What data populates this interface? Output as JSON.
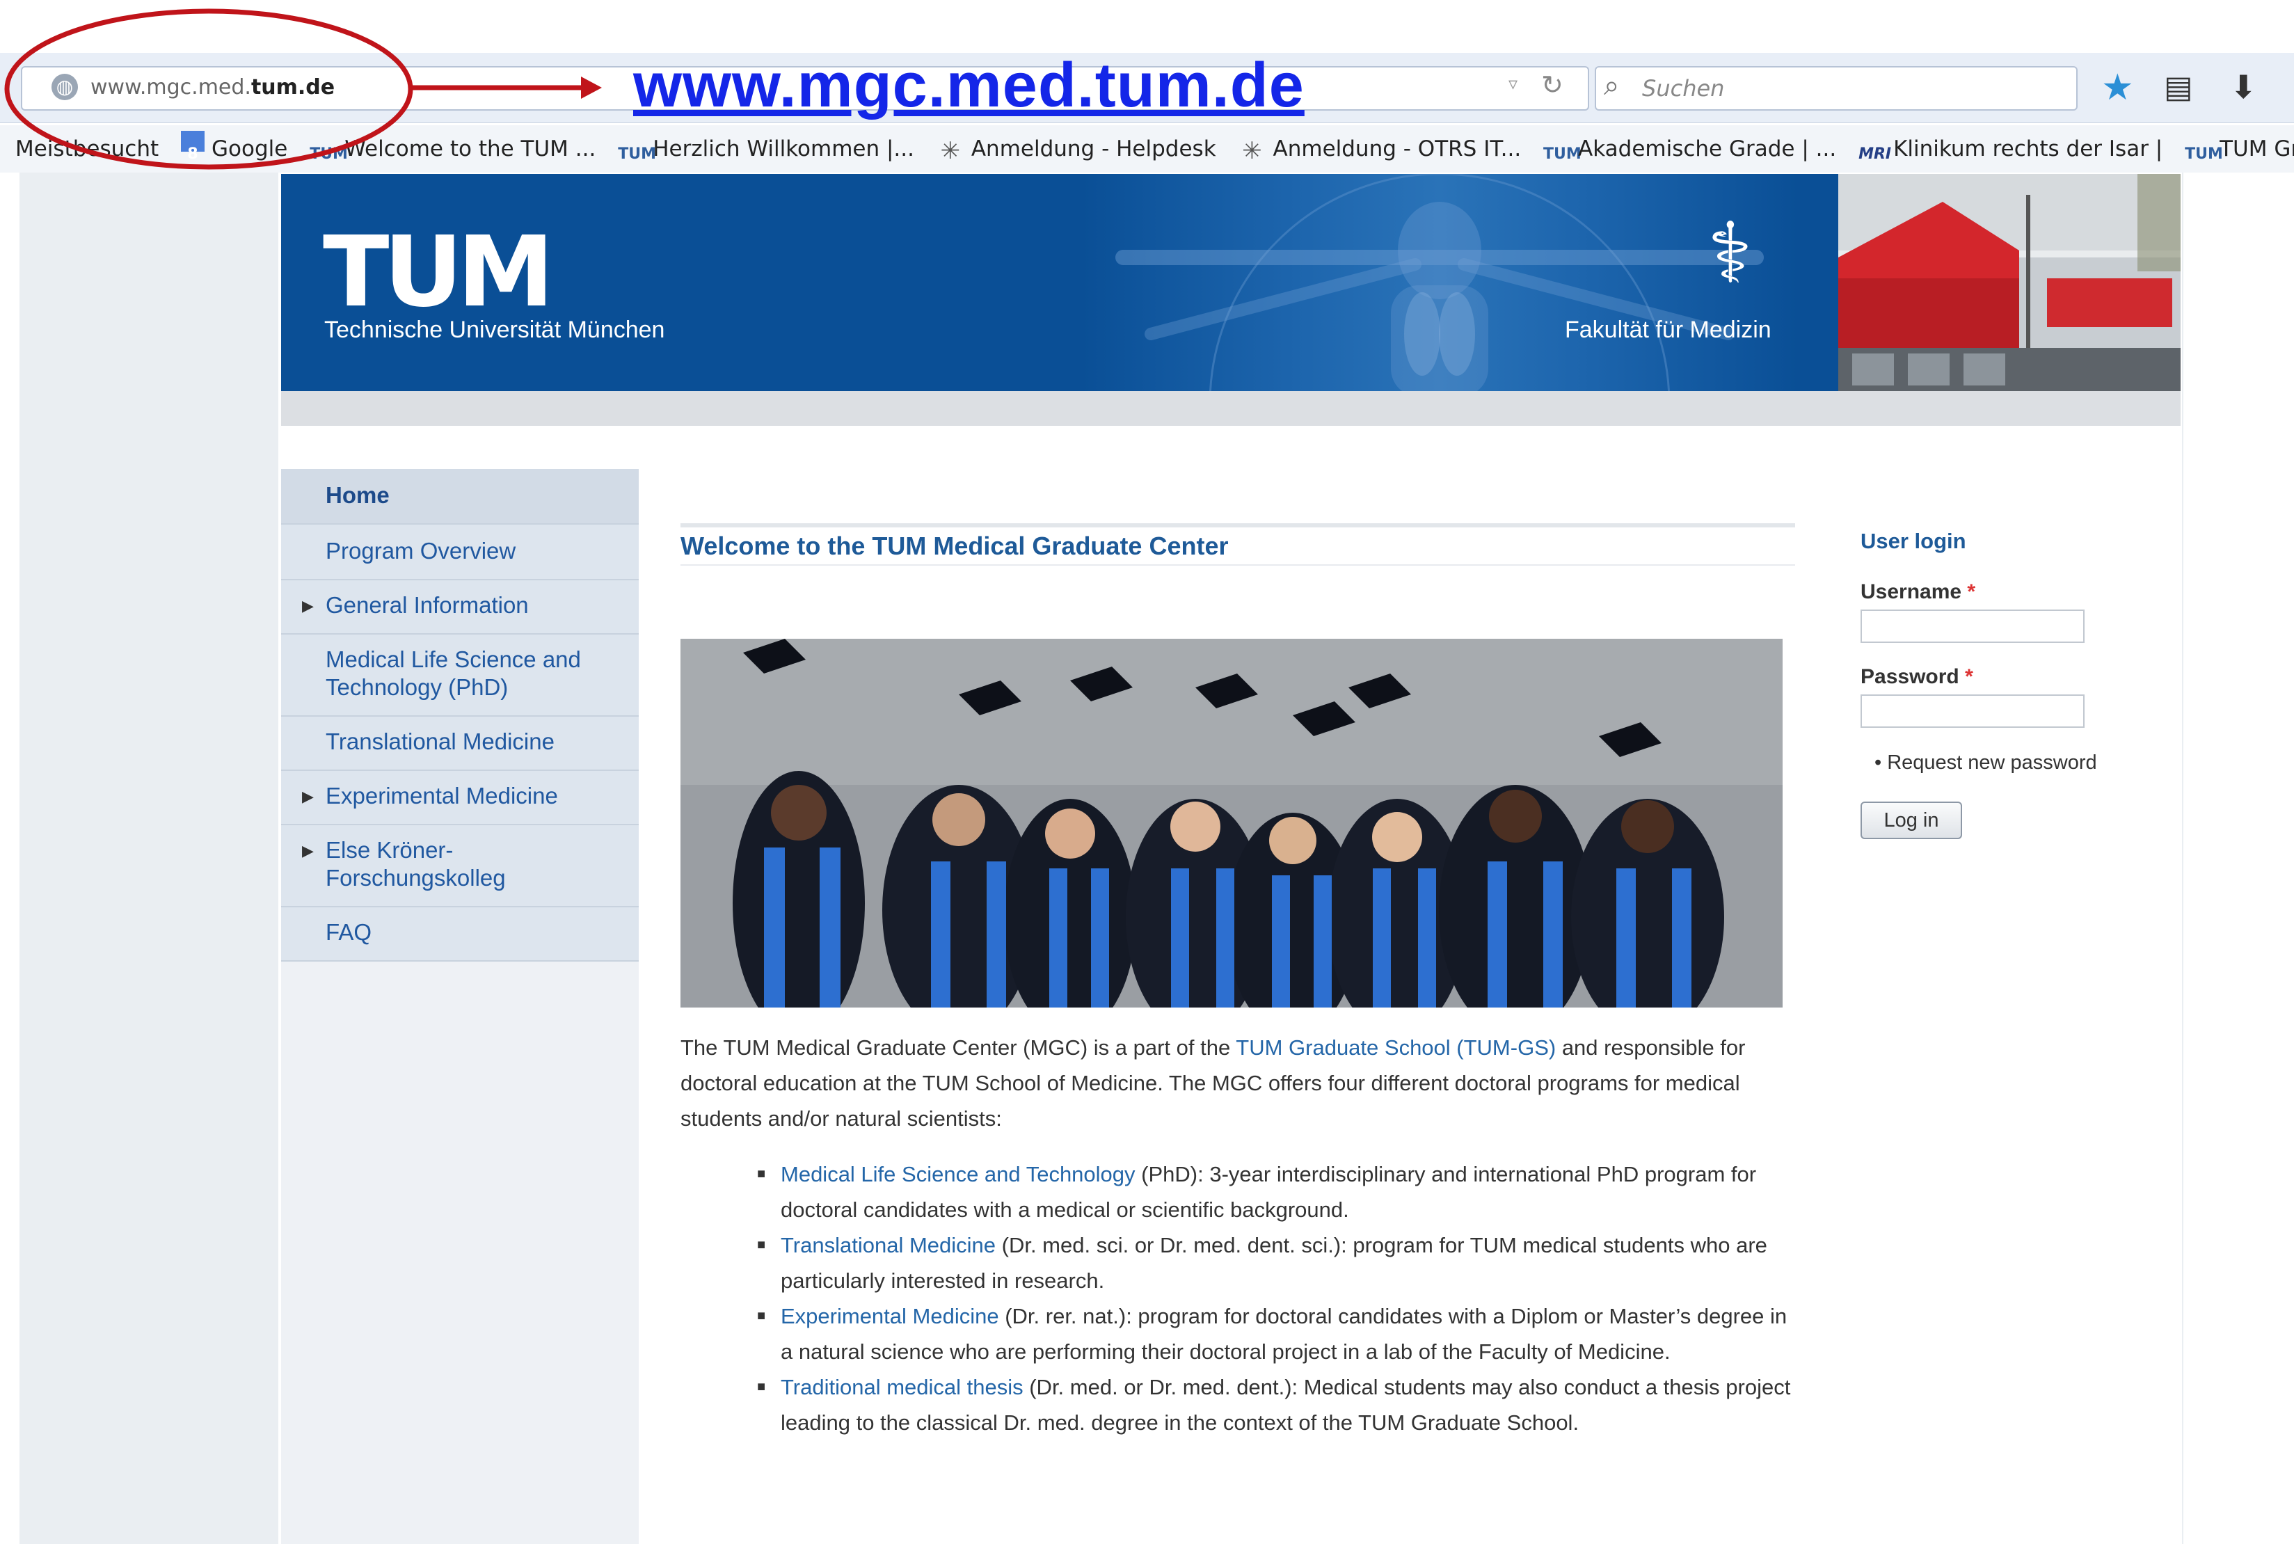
{
  "browser": {
    "url_prefix": "www.mgc.med.",
    "url_domain": "tum.de",
    "search_placeholder": "Suchen",
    "annotation_url": "www.mgc.med.tum.de",
    "bookmarks": [
      {
        "label": "Meistbesucht",
        "icon": "none"
      },
      {
        "label": "Google",
        "icon": "google-icon"
      },
      {
        "label": "Welcome to the TUM ...",
        "icon": "tum-icon"
      },
      {
        "label": "Herzlich Willkommen |...",
        "icon": "tum-icon"
      },
      {
        "label": "Anmeldung - Helpdesk",
        "icon": "star-burst-icon"
      },
      {
        "label": "Anmeldung - OTRS IT...",
        "icon": "star-burst-icon"
      },
      {
        "label": "Akademische Grade | ...",
        "icon": "tum-icon"
      },
      {
        "label": "Klinikum rechts der Isar |",
        "icon": "mri-icon"
      },
      {
        "label": "TUM Grad",
        "icon": "tum-icon"
      }
    ]
  },
  "header": {
    "logo": "TUM",
    "university": "Technische Universität München",
    "faculty": "Fakultät für Medizin"
  },
  "nav": {
    "items": [
      {
        "label": "Home"
      },
      {
        "label": "Program Overview"
      },
      {
        "label": "General Information"
      },
      {
        "label": "Medical Life Science and Technology (PhD)"
      },
      {
        "label": "Translational Medicine"
      },
      {
        "label": "Experimental Medicine"
      },
      {
        "label": "Else Kröner-Forschungskolleg"
      },
      {
        "label": "FAQ"
      }
    ]
  },
  "main": {
    "title": "Welcome to the TUM Medical Graduate Center",
    "intro_1": "The TUM Medical Graduate Center (MGC) is a part of the ",
    "intro_link": "TUM Graduate School (TUM-GS)",
    "intro_2": " and responsible for doctoral education at the TUM School of Medicine. The MGC offers four different doctoral programs for medical students and/or natural scientists:",
    "programs": [
      {
        "link": "Medical Life Science and Technology",
        "text": " (PhD): 3-year interdisciplinary and international PhD program for doctoral candidates with a medical or scientific background."
      },
      {
        "link": "Translational Medicine",
        "text": " (Dr. med. sci. or Dr. med. dent. sci.): program for TUM medical students who are particularly interested in research."
      },
      {
        "link": "Experimental Medicine",
        "text": " (Dr. rer. nat.): program for doctoral candidates with a Diplom or Master’s degree in a natural science who are performing their doctoral project in a lab of the Faculty of Medicine."
      },
      {
        "link": "Traditional medical thesis",
        "text": " (Dr. med. or Dr. med. dent.): Medical students may also conduct a thesis project leading to the classical Dr. med. degree in the context of the TUM Graduate School."
      }
    ]
  },
  "login": {
    "title": "User login",
    "username_label": "Username",
    "password_label": "Password",
    "required_mark": "*",
    "request_password": "Request new password",
    "button": "Log in"
  }
}
